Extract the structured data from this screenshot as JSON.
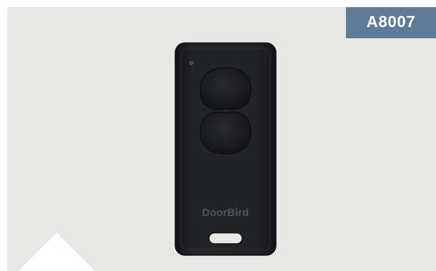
{
  "badge": {
    "label": "A8007",
    "color": "#5f7a95"
  },
  "product": {
    "brand_label": "DoorBird",
    "type": "remote-keyfob",
    "body_color": "#1c1d1f",
    "button_count": 2
  },
  "background_color": "#e7e8e6"
}
